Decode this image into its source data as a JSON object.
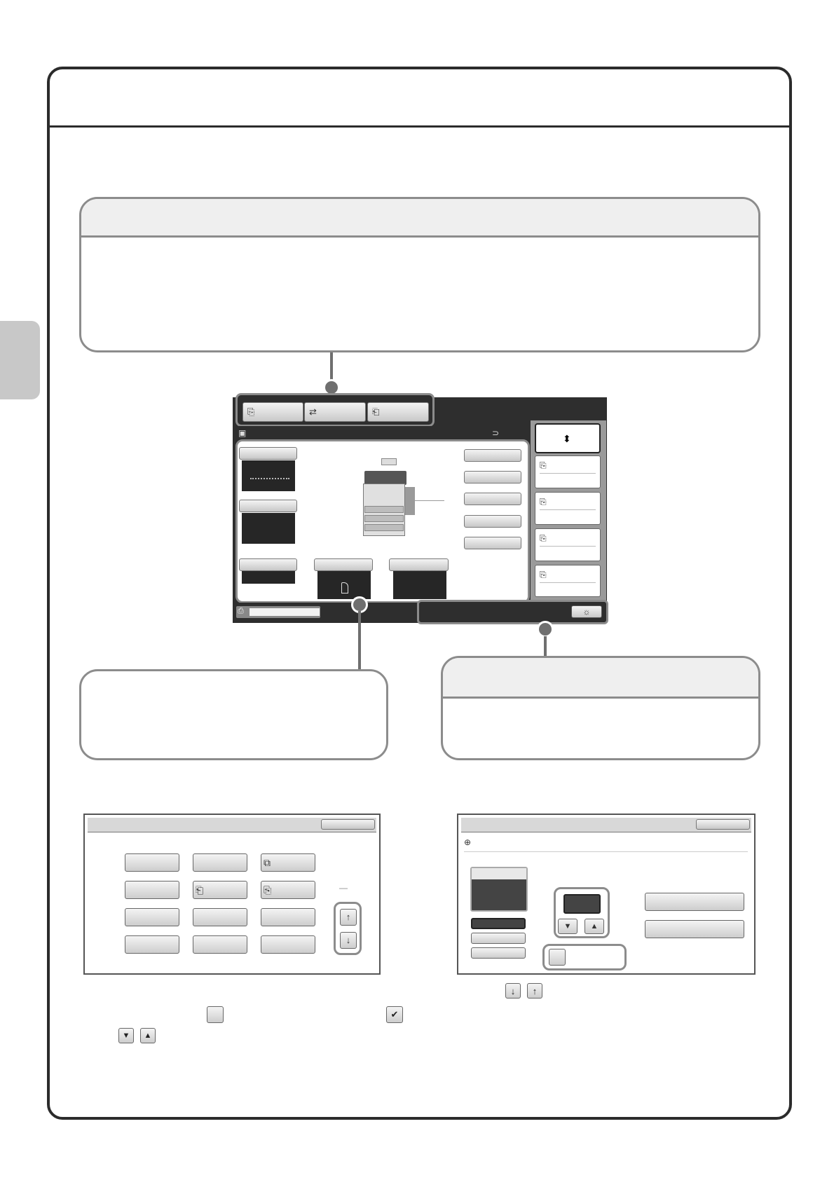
{
  "colors": {
    "frame": "#2b2b2b",
    "callout_border": "#8c8c8c",
    "panel_dark": "#2e2e2e",
    "side_tab": "#c8c8c8"
  },
  "icons": {
    "copy_mode": "copy-icon",
    "image_send_mode": "image-send-icon",
    "document_filing_mode": "document-filing-icon",
    "sort_toggle": "up-down-arrow-icon",
    "job_card": "copy-icon",
    "job_status": "sun-icon",
    "machine": "copier-icon",
    "scroll_up": "up-arrow-icon",
    "scroll_down": "down-arrow-icon",
    "triangle_down": "triangle-down-icon",
    "triangle_up": "triangle-up-icon",
    "checkbox_empty": "empty-checkbox-icon",
    "checkbox_checked": "checkmark-icon"
  },
  "main_panel": {
    "subhead_icon": "▣",
    "subhead_right_icon": "⊃"
  },
  "lower_left": {
    "separator": "—"
  },
  "lower_right": {
    "header_icon": "⊕"
  }
}
